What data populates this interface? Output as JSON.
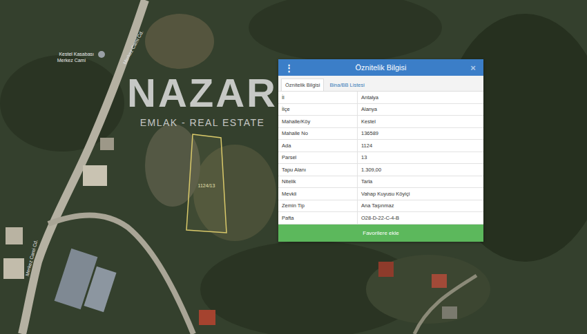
{
  "map": {
    "road_labels": [
      "Merkez Cami Cd.",
      "Merkez Cami Cd."
    ],
    "poi": {
      "lines": [
        "Kestel Kasabası",
        "Merkez Cami"
      ]
    },
    "parcel_label": "1124/13"
  },
  "watermark": {
    "logo": "NAZAR",
    "tagline": "EMLAK - REAL ESTATE"
  },
  "panel": {
    "title": "Öznitelik Bilgisi",
    "menu_icon": "⋮",
    "close": "×",
    "tabs": [
      {
        "label": "Öznitelik Bilgisi",
        "selected": true
      },
      {
        "label": "Bina/BB Listesi",
        "selected": false
      }
    ],
    "rows": [
      {
        "label": "İl",
        "value": "Antalya"
      },
      {
        "label": "İlçe",
        "value": "Alanya"
      },
      {
        "label": "Mahalle/Köy",
        "value": "Kestel"
      },
      {
        "label": "Mahalle No",
        "value": "136589"
      },
      {
        "label": "Ada",
        "value": "1124"
      },
      {
        "label": "Parsel",
        "value": "13"
      },
      {
        "label": "Tapu Alanı",
        "value": "1.309,00"
      },
      {
        "label": "Nitelik",
        "value": "Tarla"
      },
      {
        "label": "Mevkii",
        "value": "Vahap Kuyusu Köyiçi"
      },
      {
        "label": "Zemin Tip",
        "value": "Ana Taşınmaz"
      },
      {
        "label": "Pafta",
        "value": "O28-D-22-C-4-B"
      }
    ],
    "button": "Favorilere ekle"
  }
}
